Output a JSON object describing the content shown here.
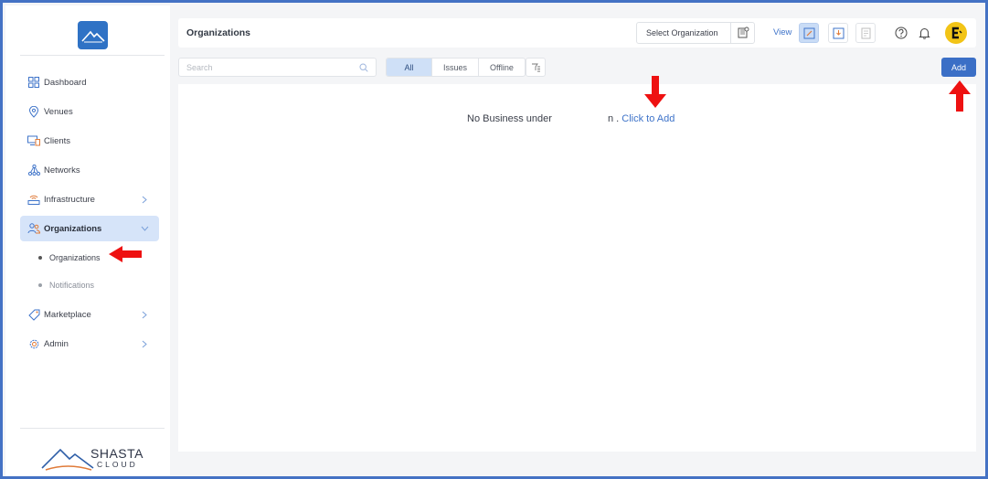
{
  "sidebar": {
    "brand_name": "SHASTA",
    "brand_sub": "CLOUD",
    "items": [
      {
        "label": "Dashboard",
        "icon": "grid-icon"
      },
      {
        "label": "Venues",
        "icon": "location-pin-icon"
      },
      {
        "label": "Clients",
        "icon": "devices-icon"
      },
      {
        "label": "Networks",
        "icon": "network-icon"
      },
      {
        "label": "Infrastructure",
        "icon": "router-icon"
      },
      {
        "label": "Organizations",
        "icon": "users-icon"
      },
      {
        "label": "Marketplace",
        "icon": "tag-icon"
      },
      {
        "label": "Admin",
        "icon": "gear-icon"
      }
    ],
    "sub_items": [
      {
        "label": "Organizations"
      },
      {
        "label": "Notifications"
      }
    ]
  },
  "header": {
    "title": "Organizations",
    "select_org_label": "Select Organization",
    "view_label": "View"
  },
  "toolbar": {
    "search_placeholder": "Search",
    "filters": [
      "All",
      "Issues",
      "Offline"
    ],
    "add_label": "Add"
  },
  "content": {
    "empty_prefix": "No Business under ",
    "empty_visible_tail": "n .",
    "empty_link": "Click to Add"
  },
  "colors": {
    "accent": "#3b6fc6",
    "active_nav_bg": "#d6e4f9",
    "annotation_arrow": "#ee1111",
    "frame_border": "#4472c4"
  }
}
